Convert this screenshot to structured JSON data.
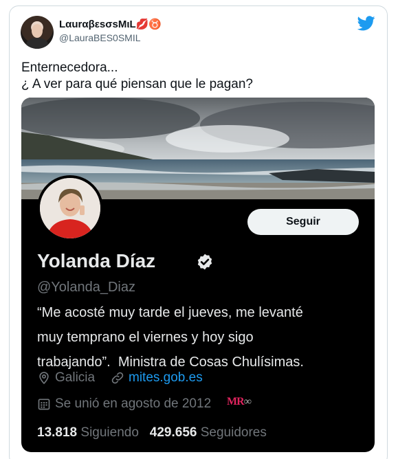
{
  "tweet": {
    "author_display_name": "LαurαβεsσsMιL💋♉",
    "author_handle": "@LauraBES0SMIL",
    "text": "Enternecedora...\n¿ A ver para qué piensan que le pagan?"
  },
  "profile_card": {
    "follow_label": "Seguir",
    "name": "Yolanda Díaz",
    "handle": "@Yolanda_Diaz",
    "bio": "“Me acosté muy tarde el jueves, me levanté\nmuy temprano el viernes y hoy sigo\ntrabajando”.  Ministra de Cosas Chulísimas.",
    "location": "Galicia",
    "website": "mites.gob.es",
    "joined": "Se unió en agosto de 2012",
    "watermark": "MR",
    "following_count": "13.818",
    "following_label": "Siguiendo",
    "followers_count": "429.656",
    "followers_label": "Seguidores"
  },
  "icons": {
    "brand": "twitter-bird-icon",
    "verified": "verified-badge-icon",
    "location": "location-pin-icon",
    "link": "link-icon",
    "calendar": "calendar-icon"
  },
  "colors": {
    "twitter_blue": "#1d9bf0",
    "card_background": "#000000",
    "secondary_text": "#71767b"
  }
}
